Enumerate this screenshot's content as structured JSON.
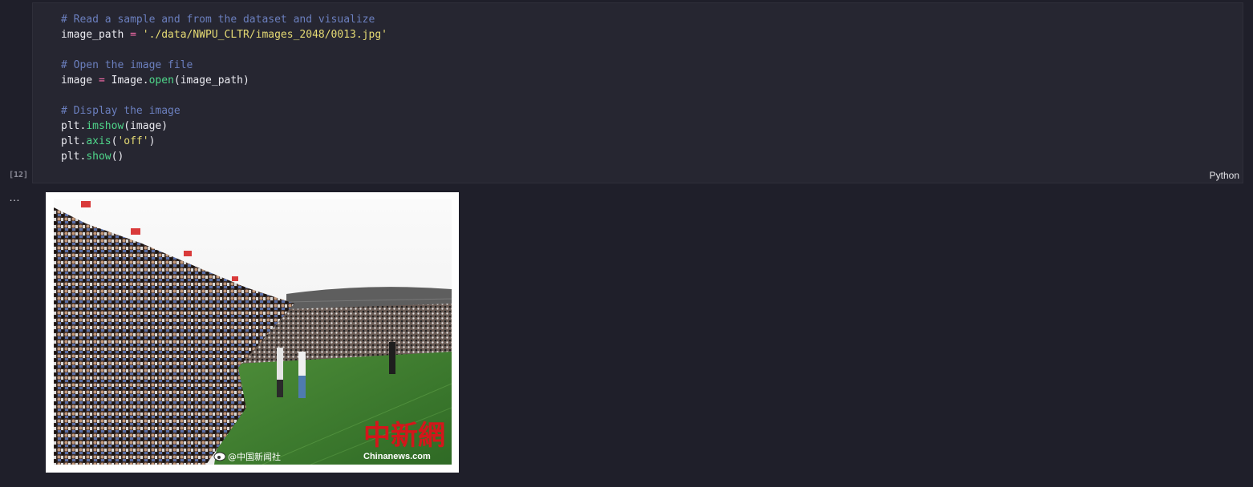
{
  "cell": {
    "execution_count": "[12]",
    "language": "Python",
    "code_lines": [
      [
        {
          "c": "cm",
          "t": "# Read a sample and from the dataset and visualize"
        }
      ],
      [
        {
          "c": "",
          "t": "image_path "
        },
        {
          "c": "op",
          "t": "="
        },
        {
          "c": "",
          "t": " "
        },
        {
          "c": "st",
          "t": "'./data/NWPU_CLTR/images_2048/0013.jpg'"
        }
      ],
      [
        {
          "c": "",
          "t": ""
        }
      ],
      [
        {
          "c": "cm",
          "t": "# Open the image file"
        }
      ],
      [
        {
          "c": "",
          "t": "image "
        },
        {
          "c": "op",
          "t": "="
        },
        {
          "c": "",
          "t": " Image."
        },
        {
          "c": "fn",
          "t": "open"
        },
        {
          "c": "",
          "t": "(image_path)"
        }
      ],
      [
        {
          "c": "",
          "t": ""
        }
      ],
      [
        {
          "c": "cm",
          "t": "# Display the image"
        }
      ],
      [
        {
          "c": "",
          "t": "plt."
        },
        {
          "c": "fn",
          "t": "imshow"
        },
        {
          "c": "",
          "t": "(image)"
        }
      ],
      [
        {
          "c": "",
          "t": "plt."
        },
        {
          "c": "fn",
          "t": "axis"
        },
        {
          "c": "",
          "t": "("
        },
        {
          "c": "st",
          "t": "'off'"
        },
        {
          "c": "",
          "t": ")"
        }
      ],
      [
        {
          "c": "",
          "t": "plt."
        },
        {
          "c": "fn",
          "t": "show"
        },
        {
          "c": "",
          "t": "()"
        }
      ]
    ]
  },
  "output": {
    "more_label": "…",
    "watermark_weibo": "@中国新闻社",
    "watermark_logo": "中新網",
    "watermark_site": "Chinanews.com"
  }
}
